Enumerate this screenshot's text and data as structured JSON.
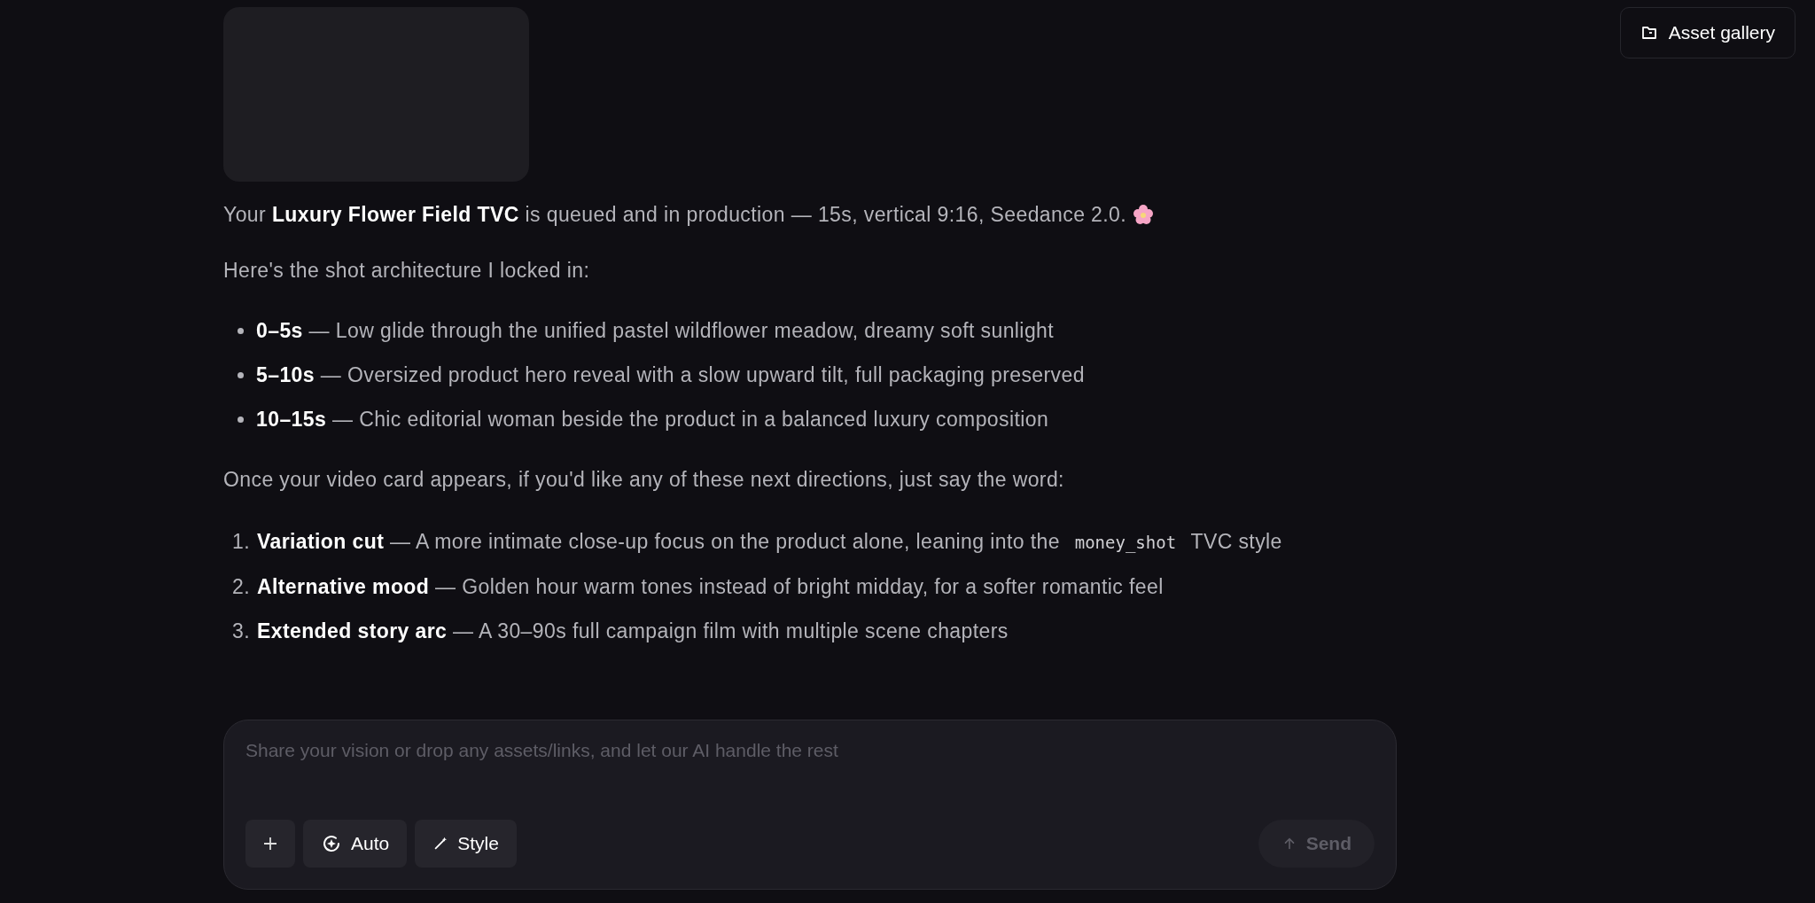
{
  "header": {
    "asset_gallery_button": "Asset gallery"
  },
  "message": {
    "media": {
      "kind": "placeholder"
    },
    "intro": "Your **Luxury Flower Field TVC** is queued and in production — 15s, vertical 9:16, Seedance 2.0.",
    "shots_heading": "Here's the shot architecture I locked in:",
    "shots": [
      {
        "time": "0–5s",
        "text": " — Low glide through the unified pastel wildflower meadow, dreamy soft sunlight"
      },
      {
        "time": "5–10s",
        "text": " — Oversized product hero reveal with a slow upward tilt, full packaging preserved"
      },
      {
        "time": "10–15s",
        "text": " — Chic editorial woman beside the product in a balanced luxury composition"
      }
    ],
    "next_heading": "Once your video card appears, if you'd like any of these next directions, just say the word:",
    "directions": [
      {
        "number": "1.",
        "parts": [
          {
            "kind": "bold",
            "text": "Variation cut"
          },
          {
            "kind": "text",
            "text": " — A more intimate close-up focus on the product alone, leaning into the "
          },
          {
            "kind": "code",
            "text": "money_shot"
          },
          {
            "kind": "text",
            "text": " TVC style"
          }
        ]
      },
      {
        "number": "2.",
        "parts": [
          {
            "kind": "bold",
            "text": "Alternative mood"
          },
          {
            "kind": "text",
            "text": " — Golden hour warm tones instead of bright midday, for a softer romantic feel"
          }
        ]
      },
      {
        "number": "3.",
        "parts": [
          {
            "kind": "bold",
            "text": "Extended story arc"
          },
          {
            "kind": "text",
            "text": " — A 30–90s full campaign film with multiple scene chapters"
          }
        ]
      }
    ]
  },
  "composer": {
    "placeholder": "Share your vision or drop any assets/links, and let our AI handle the rest",
    "tools": [
      {
        "kind": "add"
      },
      {
        "kind": "auto",
        "label": "Auto"
      },
      {
        "kind": "style",
        "label": "Style"
      }
    ],
    "send": {
      "label": "Send",
      "disabled": true
    }
  }
}
